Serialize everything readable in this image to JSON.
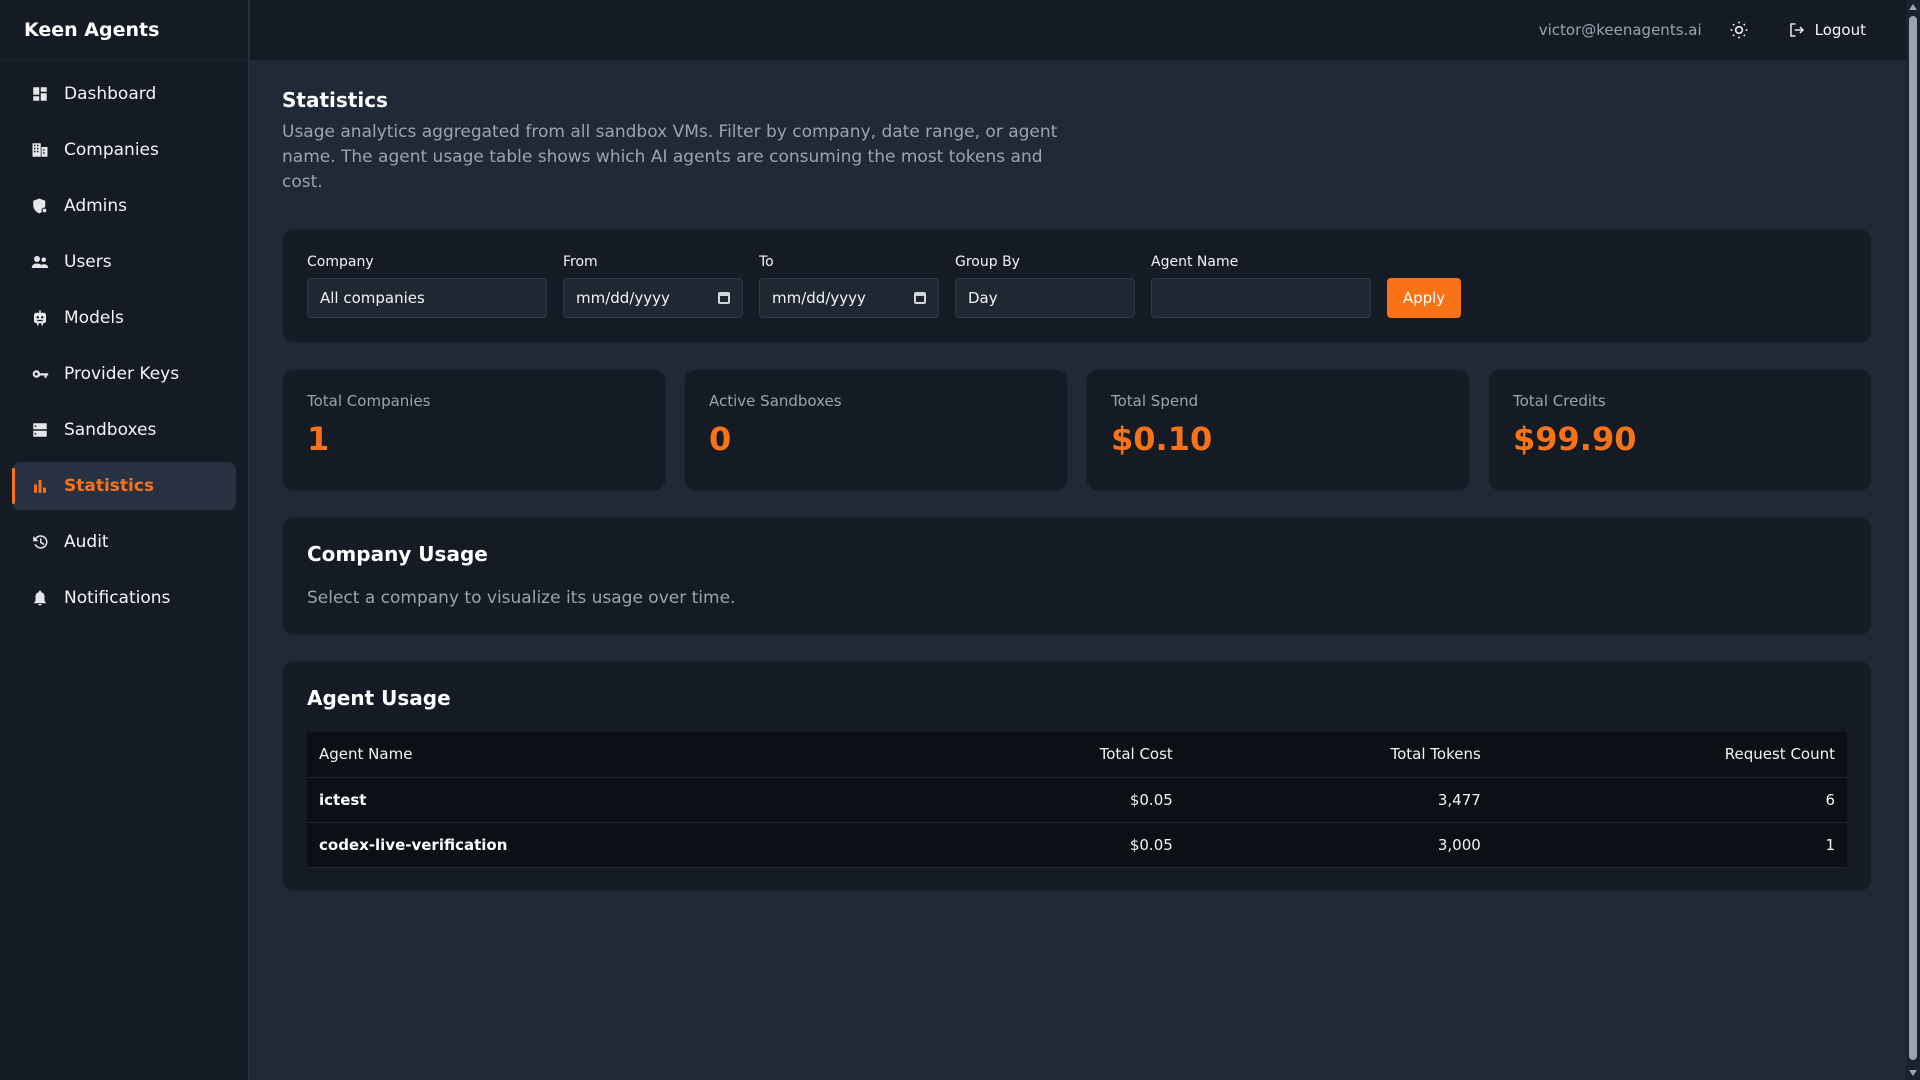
{
  "brand": "Keen Agents",
  "sidebar": {
    "items": [
      {
        "label": "Dashboard",
        "icon": "dashboard-icon"
      },
      {
        "label": "Companies",
        "icon": "building-icon"
      },
      {
        "label": "Admins",
        "icon": "admin-shield-icon"
      },
      {
        "label": "Users",
        "icon": "users-icon"
      },
      {
        "label": "Models",
        "icon": "robot-icon"
      },
      {
        "label": "Provider Keys",
        "icon": "key-icon"
      },
      {
        "label": "Sandboxes",
        "icon": "server-icon"
      },
      {
        "label": "Statistics",
        "icon": "bar-chart-icon",
        "active": true
      },
      {
        "label": "Audit",
        "icon": "history-icon"
      },
      {
        "label": "Notifications",
        "icon": "bell-icon"
      }
    ]
  },
  "topbar": {
    "user_email": "victor@keenagents.ai",
    "theme_icon": "sun-icon",
    "logout_label": "Logout",
    "logout_icon": "logout-icon"
  },
  "page": {
    "title": "Statistics",
    "description": "Usage analytics aggregated from all sandbox VMs. Filter by company, date range, or agent name. The agent usage table shows which AI agents are consuming the most tokens and cost."
  },
  "filters": {
    "company": {
      "label": "Company",
      "value": "All companies"
    },
    "from": {
      "label": "From",
      "value": "mm/dd/yyyy"
    },
    "to": {
      "label": "To",
      "value": "mm/dd/yyyy"
    },
    "group_by": {
      "label": "Group By",
      "value": "Day"
    },
    "agent_name": {
      "label": "Agent Name",
      "value": ""
    },
    "apply_label": "Apply"
  },
  "stats": [
    {
      "label": "Total Companies",
      "value": "1"
    },
    {
      "label": "Active Sandboxes",
      "value": "0"
    },
    {
      "label": "Total Spend",
      "value": "$0.10"
    },
    {
      "label": "Total Credits",
      "value": "$99.90"
    }
  ],
  "company_usage": {
    "title": "Company Usage",
    "message": "Select a company to visualize its usage over time."
  },
  "agent_usage": {
    "title": "Agent Usage",
    "columns": [
      "Agent Name",
      "Total Cost",
      "Total Tokens",
      "Request Count"
    ],
    "rows": [
      [
        "ictest",
        "$0.05",
        "3,477",
        "6"
      ],
      [
        "codex-live-verification",
        "$0.05",
        "3,000",
        "1"
      ]
    ]
  },
  "colors": {
    "accent": "#f97316",
    "background": "#1f2937",
    "panel": "#141b25"
  }
}
